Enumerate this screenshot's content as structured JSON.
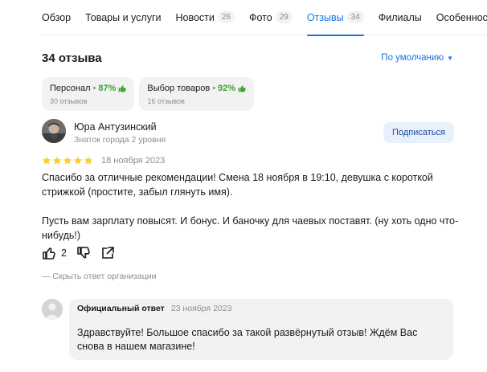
{
  "tabs": [
    {
      "label": "Обзор",
      "count": null,
      "active": false
    },
    {
      "label": "Товары и услуги",
      "count": null,
      "active": false
    },
    {
      "label": "Новости",
      "count": "26",
      "active": false
    },
    {
      "label": "Фото",
      "count": "29",
      "active": false
    },
    {
      "label": "Отзывы",
      "count": "34",
      "active": true
    },
    {
      "label": "Филиалы",
      "count": null,
      "active": false
    },
    {
      "label": "Особенности",
      "count": null,
      "active": false
    }
  ],
  "reviews": {
    "title": "34 отзыва",
    "sort_label": "По умолчанию",
    "sort_caret": "▼"
  },
  "aspects": [
    {
      "name": "Персонал",
      "sep": "•",
      "percent": "87%",
      "count": "30 отзывов"
    },
    {
      "name": "Выбор товаров",
      "sep": "•",
      "percent": "92%",
      "count": "16 отзывов"
    }
  ],
  "review": {
    "author": "Юра Антузинский",
    "level": "Знаток города 2 уровня",
    "subscribe_label": "Подписаться",
    "rating": 5,
    "rating_max": 5,
    "date": "18 ноября 2023",
    "paragraph_1": "Спасибо за отличные рекомендации! Смена 18 ноября в 19:10, девушка с короткой стрижкой (простите, забыл глянуть имя).",
    "paragraph_2": "Пусть вам зарплату повысят. И бонус. И баночку для чаевых поставят. (ну хоть одно что-нибудь!)",
    "likes": "2",
    "hide_answer": "— Скрыть ответ организации"
  },
  "response": {
    "who": "Официальный ответ",
    "date": "23 ноября 2023",
    "text": "Здравствуйте! Большое спасибо за такой развёрнутый отзыв! Ждём Вас снова в нашем магазине!"
  },
  "colors": {
    "accent": "#1a73e8",
    "star": "#fc3",
    "positive": "#3aa335",
    "chip_bg": "#f2f2f2"
  },
  "icons": [
    "thumb-up-icon",
    "thumb-down-icon",
    "share-icon",
    "star-icon",
    "user-avatar",
    "org-logo-icon"
  ]
}
